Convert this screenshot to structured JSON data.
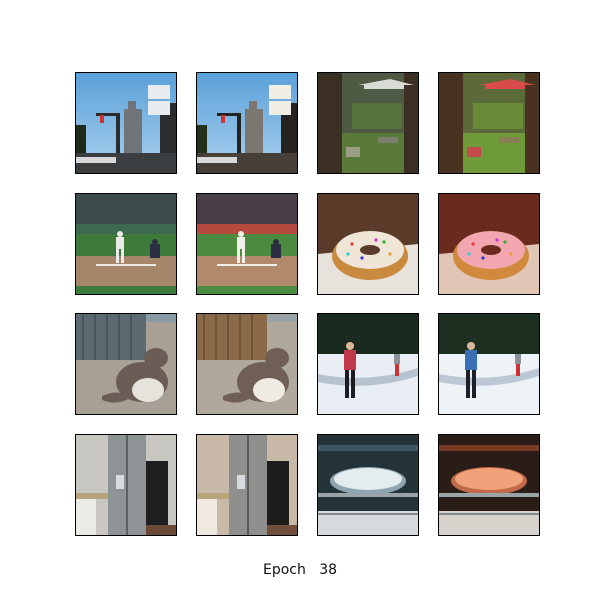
{
  "caption": "Epoch   38",
  "grid": {
    "rows": 4,
    "cols": 4,
    "tiles": [
      {
        "subject": "street-traffic-light",
        "kind": "street",
        "tone": "input"
      },
      {
        "subject": "street-traffic-light",
        "kind": "street",
        "tone": "output"
      },
      {
        "subject": "garden-umbrella",
        "kind": "garden",
        "tone": "input"
      },
      {
        "subject": "garden-umbrella",
        "kind": "garden",
        "tone": "output"
      },
      {
        "subject": "baseball-batter",
        "kind": "baseball",
        "tone": "input"
      },
      {
        "subject": "baseball-batter",
        "kind": "baseball",
        "tone": "output"
      },
      {
        "subject": "donut",
        "kind": "donut",
        "tone": "input"
      },
      {
        "subject": "donut",
        "kind": "donut",
        "tone": "output"
      },
      {
        "subject": "cat-by-fence",
        "kind": "cat",
        "tone": "input"
      },
      {
        "subject": "cat-by-fence",
        "kind": "cat",
        "tone": "output"
      },
      {
        "subject": "person-in-snow",
        "kind": "snow",
        "tone": "input"
      },
      {
        "subject": "person-in-snow",
        "kind": "snow",
        "tone": "output"
      },
      {
        "subject": "kitchen-fridge",
        "kind": "fridge",
        "tone": "input"
      },
      {
        "subject": "kitchen-fridge",
        "kind": "fridge",
        "tone": "output"
      },
      {
        "subject": "pizza-in-oven",
        "kind": "oven",
        "tone": "input"
      },
      {
        "subject": "pizza-in-oven",
        "kind": "oven",
        "tone": "output"
      }
    ]
  }
}
